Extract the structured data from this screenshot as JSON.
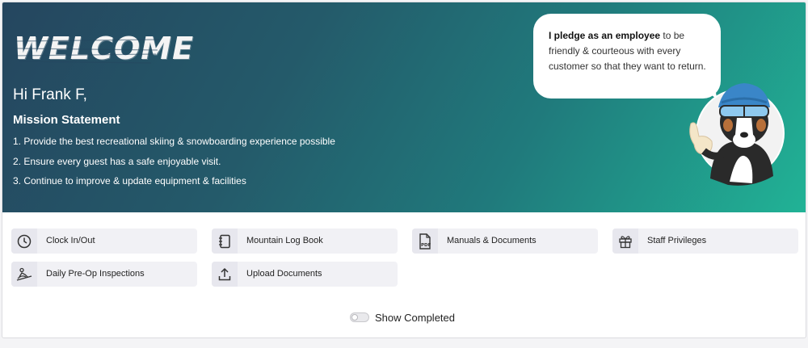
{
  "hero": {
    "welcome_text": "WELCOME",
    "greeting": "Hi Frank F,",
    "mission_title": "Mission Statement",
    "mission_items": [
      "1. Provide the best recreational skiing & snowboarding experience possible",
      "2. Ensure every guest has a safe enjoyable visit.",
      "3. Continue to improve & update equipment & facilities"
    ],
    "pledge_bold": "I pledge as an employee",
    "pledge_rest": " to be friendly & courteous with every customer so that they want to return.",
    "mascot": "dog-mascot-thumbs-up"
  },
  "tiles": [
    {
      "label": "Clock In/Out",
      "icon": "clock-icon"
    },
    {
      "label": "Mountain Log Book",
      "icon": "notebook-icon"
    },
    {
      "label": "Manuals & Documents",
      "icon": "pdf-icon"
    },
    {
      "label": "Staff Privileges",
      "icon": "gift-icon"
    },
    {
      "label": "Daily Pre-Op Inspections",
      "icon": "ski-lift-icon"
    },
    {
      "label": "Upload Documents",
      "icon": "upload-icon"
    }
  ],
  "show_completed": {
    "label": "Show Completed",
    "checked": false
  },
  "colors": {
    "gradient_start": "#25465f",
    "gradient_end": "#21b396",
    "tile_bg": "#f1f1f5"
  }
}
